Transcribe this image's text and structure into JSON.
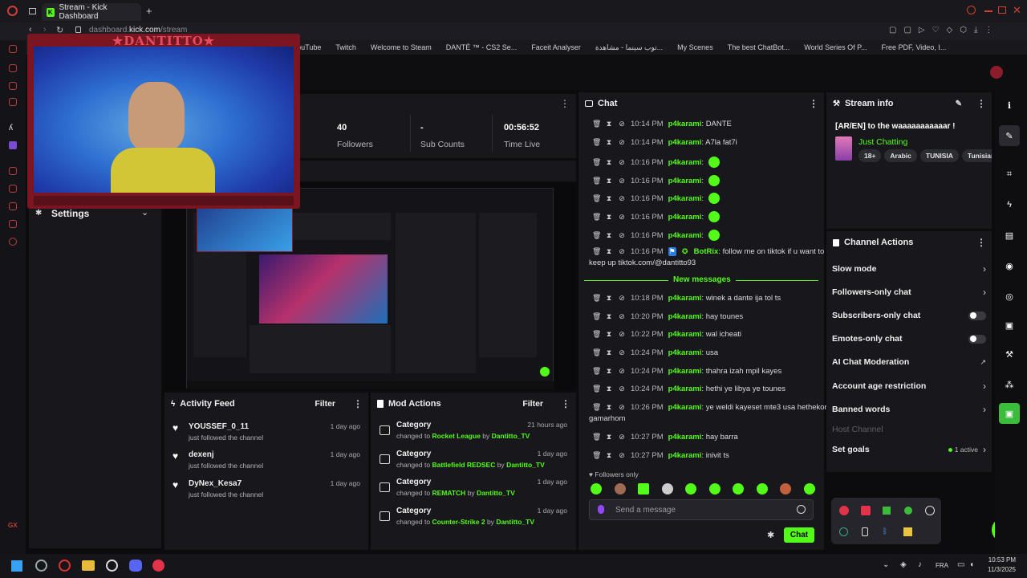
{
  "browser": {
    "tab_title": "Stream - Kick Dashboard",
    "url_prefix": "dashboard.",
    "url_domain": "kick.com",
    "url_path": "/stream",
    "bookmarks": [
      "YouTube",
      "Twitch",
      "Welcome to Steam",
      "DANTÉ ™ - CS2 Se...",
      "Faceit Analyser",
      "توب سينما - مشاهدة...",
      "My Scenes",
      "The best ChatBot...",
      "World Series Of P...",
      "Free PDF, Video, I..."
    ]
  },
  "overlay": {
    "streamer_name": "★DANTITTO★"
  },
  "stats": [
    {
      "value": "40",
      "label": "Followers"
    },
    {
      "value": "-",
      "label": "Sub Counts"
    },
    {
      "value": "00:56:52",
      "label": "Time Live"
    }
  ],
  "settings": {
    "label": "Settings"
  },
  "chat": {
    "title": "Chat",
    "lines": [
      {
        "time": "10:14 PM",
        "user": "p4karami",
        "msg": "DANTE"
      },
      {
        "time": "10:14 PM",
        "user": "p4karami",
        "msg": "A7la fat7i"
      },
      {
        "time": "10:16 PM",
        "user": "p4karami",
        "msg": ""
      },
      {
        "time": "10:16 PM",
        "user": "p4karami",
        "msg": ""
      },
      {
        "time": "10:16 PM",
        "user": "p4karami",
        "msg": ""
      },
      {
        "time": "10:16 PM",
        "user": "p4karami",
        "msg": ""
      },
      {
        "time": "10:16 PM",
        "user": "p4karami",
        "msg": ""
      }
    ],
    "bot_line": {
      "time": "10:16 PM",
      "user": "BotRix",
      "msg": "follow me on tiktok if u want to",
      "msg2": "keep up tiktok.com/@dantitto93"
    },
    "new_messages": "New messages",
    "lines2": [
      {
        "time": "10:18 PM",
        "user": "p4karami",
        "msg": "winek a dante ija tol ts"
      },
      {
        "time": "10:20 PM",
        "user": "p4karami",
        "msg": "hay tounes"
      },
      {
        "time": "10:22 PM",
        "user": "p4karami",
        "msg": "wal icheati"
      },
      {
        "time": "10:24 PM",
        "user": "p4karami",
        "msg": "usa"
      },
      {
        "time": "10:24 PM",
        "user": "p4karami",
        "msg": "thahra izah mpil kayes"
      },
      {
        "time": "10:24 PM",
        "user": "p4karami",
        "msg": "hethi ye libya ye tounes"
      },
      {
        "time": "10:26 PM",
        "user": "p4karami",
        "msg": "ye weldi kayeset mte3 usa hethekom",
        "msg2": "gamarhom"
      },
      {
        "time": "10:27 PM",
        "user": "p4karami",
        "msg": "hay barra"
      },
      {
        "time": "10:27 PM",
        "user": "p4karami",
        "msg": "inivit ts"
      }
    ],
    "followers_only": "Followers only",
    "input_placeholder": "Send a message",
    "send_label": "Chat"
  },
  "stream_info": {
    "title": "Stream info",
    "stream_title": "[AR/EN] to the waaaaaaaaaaar !",
    "category": "Just Chatting",
    "tags": [
      "18+",
      "Arabic",
      "TUNISIA",
      "Tunisiar"
    ]
  },
  "channel_actions": {
    "title": "Channel Actions",
    "rows": [
      "Slow mode",
      "Followers-only chat",
      "Subscribers-only chat",
      "Emotes-only chat",
      "AI Chat Moderation",
      "Account age restriction",
      "Banned words",
      "Host Channel",
      "Set goals"
    ],
    "goals_active": "1 active"
  },
  "activity_feed": {
    "title": "Activity Feed",
    "filter": "Filter",
    "items": [
      {
        "name": "YOUSSEF_0_11",
        "sub": "just followed the channel",
        "time": "1 day ago"
      },
      {
        "name": "dexenj",
        "sub": "just followed the channel",
        "time": "1 day ago"
      },
      {
        "name": "DyNex_Kesa7",
        "sub": "just followed the channel",
        "time": "1 day ago"
      }
    ]
  },
  "mod_actions": {
    "title": "Mod Actions",
    "filter": "Filter",
    "items": [
      {
        "title": "Category",
        "pre": "changed to",
        "value": "Rocket League",
        "by": "by",
        "mod": "Dantitto_TV",
        "time": "21 hours ago"
      },
      {
        "title": "Category",
        "pre": "changed to",
        "value": "Battlefield REDSEC",
        "by": "by",
        "mod": "Dantitto_TV",
        "time": "1 day ago"
      },
      {
        "title": "Category",
        "pre": "changed to",
        "value": "REMATCH",
        "by": "by",
        "mod": "Dantitto_TV",
        "time": "1 day ago"
      },
      {
        "title": "Category",
        "pre": "changed to",
        "value": "Counter-Strike 2",
        "by": "by",
        "mod": "Dantitto_TV",
        "time": "1 day ago"
      }
    ]
  },
  "taskbar": {
    "lang": "FRA",
    "time": "10:53 PM",
    "date": "11/3/2025"
  },
  "colors": {
    "accent": "#53fc18",
    "panel": "#18181c",
    "bg": "#0c0c0f"
  }
}
